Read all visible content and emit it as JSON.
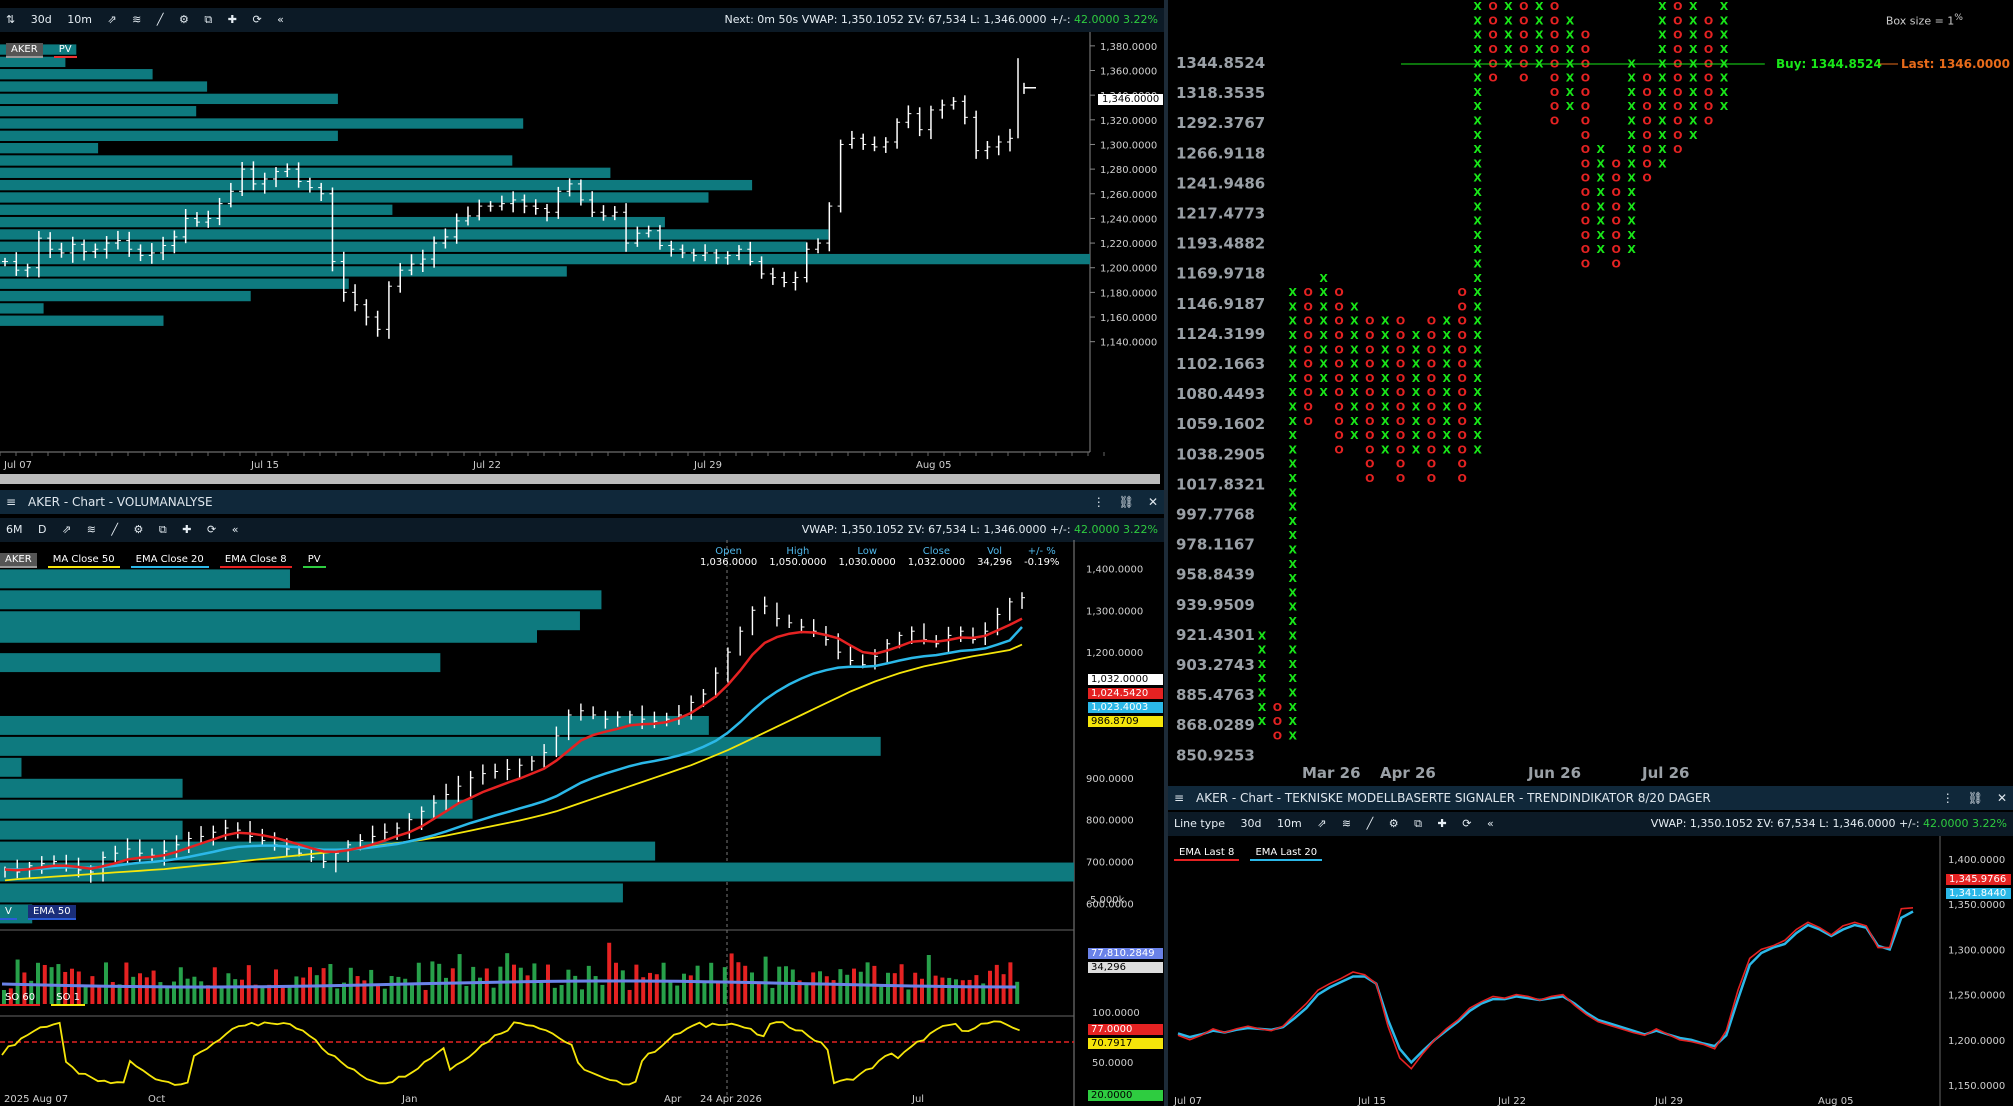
{
  "panel1": {
    "toolbar": {
      "periods": [
        "30d",
        "10m"
      ],
      "info": "Next: 0m 50s  VWAP: 1,350.1052  ΣV: 67,534  L: 1,346.0000  +/-:",
      "change": "42.0000",
      "change_pct": "3.22%"
    },
    "tags": [
      "AKER",
      "PV"
    ],
    "last_label": "1,346.0000"
  },
  "panel2": {
    "title": "AKER - Chart - VOLUMANALYSE",
    "toolbar": {
      "periods": [
        "6M",
        "D"
      ],
      "info": "VWAP: 1,350.1052  ΣV: 67,534  L: 1,346.0000  +/-:",
      "change": "42.0000",
      "change_pct": "3.22%"
    },
    "tags": [
      "AKER",
      "MA  Close 50",
      "EMA  Close 20",
      "EMA  Close 8",
      "PV"
    ],
    "ohlc": {
      "headers": [
        "Open",
        "High",
        "Low",
        "Close",
        "Vol",
        "+/- %"
      ],
      "values": [
        "1,036.0000",
        "1,050.0000",
        "1,030.0000",
        "1,032.0000",
        "34,296",
        "-0.19%"
      ]
    },
    "badges": [
      "1,032.0000",
      "1,024.5420",
      "1,023.4003",
      "986.8709"
    ],
    "vol_tags": [
      "V",
      "EMA  50"
    ],
    "vol_badges": [
      "77,810.2849",
      "34,296"
    ],
    "vol_axis": "5,000k",
    "so_tags": [
      "SO  60",
      "SO  1"
    ],
    "so_badges": [
      "77.0000",
      "70.7917"
    ],
    "so_axis": [
      "100.0000",
      "50.0000"
    ],
    "so_bottom": "20.0000",
    "crosshair_date": "24 Apr 2026"
  },
  "panel3": {
    "box_size": "Box size = 1",
    "box_pct": "%",
    "buy": "Buy: 1344.8524",
    "last": "Last: 1346.0000"
  },
  "panel4": {
    "title": "AKER - Chart - TEKNISKE MODELLBASERTE SIGNALER - TRENDINDIKATOR 8/20 DAGER",
    "toolbar": {
      "line_type": "Line type",
      "periods": [
        "30d",
        "10m"
      ],
      "info": "VWAP: 1,350.1052  ΣV: 67,534  L: 1,346.0000  +/-:",
      "change": "42.0000",
      "change_pct": "3.22%"
    },
    "tags": [
      "EMA  Last 8",
      "EMA  Last 20"
    ],
    "badges": [
      "1,345.9766",
      "1,341.8440"
    ]
  },
  "chart_data": [
    {
      "type": "ohlc",
      "name": "AKER intraday 30d/10m",
      "x_ticks": [
        "Jul 07",
        "Jul 15",
        "Jul 22",
        "Jul 29",
        "Aug 05"
      ],
      "y_ticks": [
        "1,380.0000",
        "1,360.0000",
        "1,340.0000",
        "1,320.0000",
        "1,300.0000",
        "1,280.0000",
        "1,260.0000",
        "1,240.0000",
        "1,220.0000",
        "1,200.0000",
        "1,180.0000",
        "1,160.0000",
        "1,140.0000"
      ],
      "ylim": [
        1130,
        1388
      ],
      "close_path": [
        1205,
        1198,
        1200,
        1224,
        1215,
        1212,
        1219,
        1213,
        1215,
        1220,
        1222,
        1215,
        1210,
        1212,
        1218,
        1225,
        1240,
        1237,
        1240,
        1252,
        1262,
        1280,
        1268,
        1272,
        1278,
        1280,
        1270,
        1265,
        1260,
        1205,
        1180,
        1170,
        1160,
        1150,
        1185,
        1198,
        1203,
        1207,
        1220,
        1225,
        1238,
        1242,
        1250,
        1250,
        1252,
        1255,
        1250,
        1248,
        1245,
        1262,
        1268,
        1255,
        1245,
        1242,
        1245,
        1220,
        1228,
        1230,
        1218,
        1215,
        1212,
        1210,
        1212,
        1208,
        1210,
        1215,
        1205,
        1195,
        1192,
        1188,
        1192,
        1215,
        1220,
        1250,
        1300,
        1305,
        1300,
        1298,
        1302,
        1318,
        1325,
        1312,
        1328,
        1332,
        1335,
        1322,
        1295,
        1298,
        1302,
        1305
      ],
      "last_segment": [
        1345,
        1370,
        1346
      ],
      "volume_profile": [
        {
          "price": 1377,
          "length": 0.07
        },
        {
          "price": 1367,
          "length": 0.06
        },
        {
          "price": 1357,
          "length": 0.14
        },
        {
          "price": 1347,
          "length": 0.19
        },
        {
          "price": 1337,
          "length": 0.31
        },
        {
          "price": 1327,
          "length": 0.18
        },
        {
          "price": 1317,
          "length": 0.48
        },
        {
          "price": 1307,
          "length": 0.31
        },
        {
          "price": 1297,
          "length": 0.09
        },
        {
          "price": 1287,
          "length": 0.47
        },
        {
          "price": 1277,
          "length": 0.56
        },
        {
          "price": 1267,
          "length": 0.69
        },
        {
          "price": 1257,
          "length": 0.65
        },
        {
          "price": 1247,
          "length": 0.36
        },
        {
          "price": 1237,
          "length": 0.61
        },
        {
          "price": 1227,
          "length": 0.76
        },
        {
          "price": 1217,
          "length": 0.74
        },
        {
          "price": 1207,
          "length": 1.0
        },
        {
          "price": 1197,
          "length": 0.52
        },
        {
          "price": 1187,
          "length": 0.32
        },
        {
          "price": 1177,
          "length": 0.23
        },
        {
          "price": 1167,
          "length": 0.04
        },
        {
          "price": 1157,
          "length": 0.15
        }
      ]
    },
    {
      "type": "ohlc",
      "name": "AKER daily 6M volume analysis",
      "x_ticks": [
        "2025 Aug 07",
        "Oct",
        "Jan",
        "Apr",
        "24 Apr 2026",
        "Jul"
      ],
      "y_ticks": [
        "1,400.0000",
        "1,300.0000",
        "1,200.0000",
        "900.0000",
        "800.0000",
        "700.0000",
        "600.0000"
      ],
      "ylim": [
        570,
        1420
      ],
      "close": [
        680,
        675,
        690,
        695,
        700,
        690,
        680,
        675,
        710,
        720,
        730,
        720,
        715,
        725,
        740,
        755,
        760,
        770,
        780,
        775,
        760,
        750,
        740,
        730,
        720,
        710,
        700,
        720,
        740,
        750,
        760,
        770,
        780,
        800,
        820,
        840,
        860,
        880,
        900,
        910,
        915,
        920,
        930,
        940,
        960,
        1000,
        1050,
        1060,
        1050,
        1040,
        1045,
        1050,
        1040,
        1035,
        1040,
        1050,
        1080,
        1100,
        1150,
        1200,
        1250,
        1300,
        1310,
        1280,
        1270,
        1260,
        1250,
        1230,
        1200,
        1180,
        1170,
        1190,
        1220,
        1240,
        1250,
        1230,
        1220,
        1240,
        1250,
        1230,
        1250,
        1290,
        1320,
        1330
      ],
      "ema8": [
        681,
        679,
        682,
        686,
        690,
        690,
        687,
        683,
        689,
        696,
        705,
        709,
        711,
        715,
        723,
        733,
        743,
        753,
        763,
        769,
        767,
        763,
        757,
        749,
        741,
        732,
        724,
        723,
        727,
        733,
        741,
        750,
        761,
        770,
        784,
        802,
        820,
        839,
        852,
        866,
        877,
        888,
        898,
        910,
        922,
        941,
        965,
        989,
        1002,
        1010,
        1017,
        1025,
        1028,
        1029,
        1033,
        1042,
        1055,
        1074,
        1094,
        1122,
        1156,
        1194,
        1222,
        1236,
        1244,
        1248,
        1247,
        1241,
        1233,
        1216,
        1200,
        1196,
        1204,
        1214,
        1225,
        1227,
        1225,
        1229,
        1235,
        1234,
        1239,
        1252,
        1265,
        1280
      ],
      "ema20": [
        682,
        681,
        682,
        683,
        685,
        686,
        686,
        685,
        687,
        690,
        694,
        697,
        699,
        702,
        706,
        711,
        717,
        723,
        730,
        735,
        737,
        738,
        738,
        736,
        734,
        731,
        728,
        728,
        729,
        731,
        734,
        738,
        742,
        748,
        755,
        763,
        772,
        782,
        792,
        801,
        810,
        818,
        827,
        835,
        844,
        856,
        872,
        888,
        900,
        910,
        919,
        928,
        935,
        940,
        946,
        953,
        962,
        974,
        988,
        1008,
        1033,
        1061,
        1086,
        1106,
        1123,
        1137,
        1149,
        1157,
        1163,
        1165,
        1165,
        1167,
        1173,
        1180,
        1186,
        1190,
        1193,
        1198,
        1203,
        1205,
        1209,
        1218,
        1228,
        1260
      ],
      "ma50": [
        655,
        658,
        660,
        662,
        664,
        666,
        668,
        670,
        672,
        674,
        676,
        678,
        680,
        682,
        685,
        688,
        691,
        694,
        697,
        700,
        703,
        706,
        709,
        712,
        715,
        718,
        721,
        724,
        728,
        732,
        736,
        740,
        744,
        748,
        752,
        757,
        762,
        768,
        774,
        780,
        786,
        792,
        798,
        805,
        812,
        820,
        830,
        840,
        850,
        860,
        870,
        880,
        890,
        900,
        910,
        920,
        930,
        942,
        954,
        966,
        980,
        994,
        1008,
        1022,
        1036,
        1050,
        1064,
        1078,
        1092,
        1106,
        1118,
        1130,
        1140,
        1150,
        1158,
        1166,
        1172,
        1178,
        1184,
        1190,
        1195,
        1200,
        1205,
        1218
      ],
      "volume_profile": [
        {
          "price": 1375,
          "length": 0.27
        },
        {
          "price": 1325,
          "length": 0.56
        },
        {
          "price": 1275,
          "length": 0.54
        },
        {
          "price": 1245,
          "length": 0.5
        },
        {
          "price": 1175,
          "length": 0.41
        },
        {
          "price": 1025,
          "length": 0.66
        },
        {
          "price": 975,
          "length": 0.82
        },
        {
          "price": 925,
          "length": 0.02
        },
        {
          "price": 875,
          "length": 0.17
        },
        {
          "price": 825,
          "length": 0.44
        },
        {
          "price": 775,
          "length": 0.17
        },
        {
          "price": 725,
          "length": 0.61
        },
        {
          "price": 675,
          "length": 1.0
        },
        {
          "price": 625,
          "length": 0.58
        },
        {
          "price": 575,
          "length": 0.03
        }
      ],
      "badges": {
        "close": 1032.0,
        "ema8": 1024.542,
        "ema20": 1023.4003,
        "ma50": 986.8709
      }
    },
    {
      "type": "point_and_figure",
      "name": "AKER point & figure",
      "y_ticks": [
        "1344.8524",
        "1318.3535",
        "1292.3767",
        "1266.9118",
        "1241.9486",
        "1217.4773",
        "1193.4882",
        "1169.9718",
        "1146.9187",
        "1124.3199",
        "1102.1663",
        "1080.4493",
        "1059.1602",
        "1038.2905",
        "1017.8321",
        "997.7768",
        "978.1167",
        "958.8439",
        "939.9509",
        "921.4301",
        "903.2743",
        "885.4763",
        "868.0289",
        "850.9253"
      ],
      "x_ticks": [
        "Mar 26",
        "Apr 26",
        "Jun 26",
        "Jul 26"
      ],
      "columns": [
        {
          "t": "X",
          "lo": 3,
          "hi": 9
        },
        {
          "t": "O",
          "lo": 2,
          "hi": 4
        },
        {
          "t": "X",
          "lo": 2,
          "hi": 33
        },
        {
          "t": "O",
          "lo": 24,
          "hi": 33
        },
        {
          "t": "X",
          "lo": 26,
          "hi": 34
        },
        {
          "t": "O",
          "lo": 22,
          "hi": 33
        },
        {
          "t": "X",
          "lo": 23,
          "hi": 32
        },
        {
          "t": "O",
          "lo": 20,
          "hi": 31
        },
        {
          "t": "X",
          "lo": 22,
          "hi": 31
        },
        {
          "t": "O",
          "lo": 20,
          "hi": 31
        },
        {
          "t": "X",
          "lo": 22,
          "hi": 30
        },
        {
          "t": "O",
          "lo": 20,
          "hi": 31
        },
        {
          "t": "X",
          "lo": 22,
          "hi": 31
        },
        {
          "t": "O",
          "lo": 20,
          "hi": 33
        },
        {
          "t": "X",
          "lo": 22,
          "hi": 57
        },
        {
          "t": "O",
          "lo": 48,
          "hi": 56
        },
        {
          "t": "X",
          "lo": 49,
          "hi": 55
        },
        {
          "t": "O",
          "lo": 48,
          "hi": 55
        },
        {
          "t": "X",
          "lo": 49,
          "hi": 56
        },
        {
          "t": "O",
          "lo": 45,
          "hi": 55
        },
        {
          "t": "X",
          "lo": 46,
          "hi": 52
        },
        {
          "t": "O",
          "lo": 35,
          "hi": 51
        },
        {
          "t": "X",
          "lo": 36,
          "hi": 43
        },
        {
          "t": "O",
          "lo": 35,
          "hi": 42
        },
        {
          "t": "X",
          "lo": 36,
          "hi": 49
        },
        {
          "t": "O",
          "lo": 41,
          "hi": 48
        },
        {
          "t": "X",
          "lo": 42,
          "hi": 55
        },
        {
          "t": "O",
          "lo": 43,
          "hi": 54
        },
        {
          "t": "X",
          "lo": 44,
          "hi": 53
        },
        {
          "t": "O",
          "lo": 45,
          "hi": 52
        },
        {
          "t": "X",
          "lo": 46,
          "hi": 58
        },
        {
          "t": "O",
          "lo": 55,
          "hi": 57
        },
        {
          "t": "X",
          "lo": 56,
          "hi": 61
        }
      ]
    },
    {
      "type": "line",
      "name": "Trend indicator 8/20",
      "x_ticks": [
        "Jul 07",
        "Jul 15",
        "Jul 22",
        "Jul 29",
        "Aug 05"
      ],
      "y_ticks": [
        "1,400.0000",
        "1,350.0000",
        "1,300.0000",
        "1,250.0000",
        "1,200.0000",
        "1,150.0000"
      ],
      "ylim": [
        1140,
        1410
      ],
      "ema8": [
        1205,
        1200,
        1205,
        1212,
        1208,
        1212,
        1215,
        1212,
        1210,
        1215,
        1228,
        1240,
        1255,
        1262,
        1268,
        1275,
        1272,
        1262,
        1215,
        1180,
        1168,
        1185,
        1200,
        1212,
        1222,
        1235,
        1242,
        1248,
        1246,
        1250,
        1248,
        1244,
        1248,
        1250,
        1238,
        1228,
        1220,
        1216,
        1212,
        1208,
        1205,
        1212,
        1206,
        1200,
        1198,
        1195,
        1190,
        1210,
        1255,
        1290,
        1300,
        1304,
        1310,
        1322,
        1330,
        1324,
        1316,
        1326,
        1330,
        1326,
        1302,
        1302,
        1345,
        1346
      ],
      "ema20": [
        1207,
        1203,
        1206,
        1210,
        1208,
        1211,
        1213,
        1212,
        1211,
        1214,
        1224,
        1235,
        1250,
        1258,
        1264,
        1270,
        1270,
        1262,
        1222,
        1190,
        1175,
        1188,
        1200,
        1210,
        1220,
        1232,
        1240,
        1245,
        1245,
        1248,
        1246,
        1244,
        1246,
        1248,
        1240,
        1230,
        1222,
        1218,
        1214,
        1210,
        1206,
        1210,
        1206,
        1202,
        1200,
        1196,
        1193,
        1205,
        1245,
        1283,
        1296,
        1302,
        1306,
        1318,
        1327,
        1322,
        1315,
        1322,
        1327,
        1324,
        1304,
        1300,
        1335,
        1342
      ]
    }
  ]
}
